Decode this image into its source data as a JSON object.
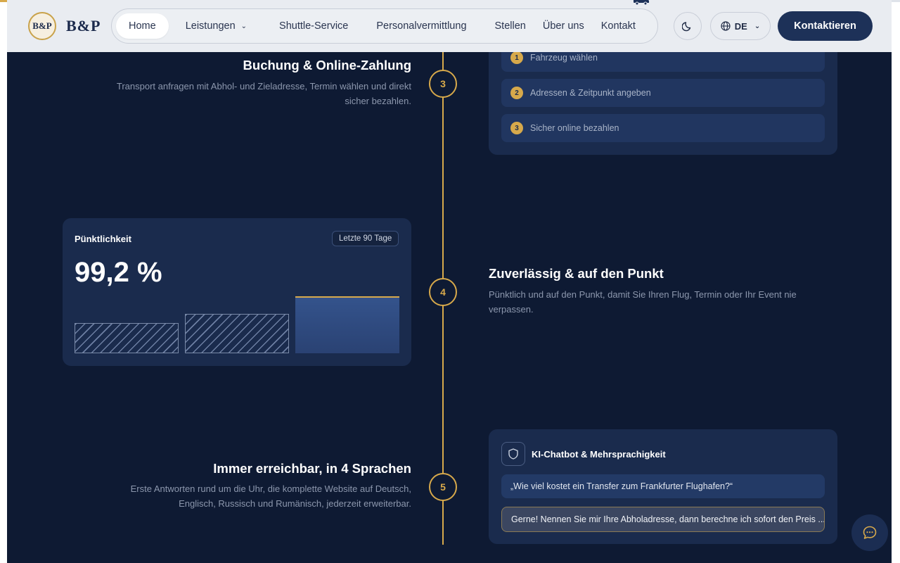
{
  "progress": {
    "fraction": 0.5
  },
  "brand": {
    "seal_text": "B&P",
    "wordmark": "B&P"
  },
  "nav": {
    "items": [
      {
        "label": "Home"
      },
      {
        "label": "Leistungen"
      },
      {
        "label": "Shuttle-Service"
      },
      {
        "label": "Personalvermittlung"
      },
      {
        "label": "Stellen"
      },
      {
        "label": "Über uns"
      },
      {
        "label": "Kontakt"
      }
    ],
    "dropdown_chevron": "⌄"
  },
  "header": {
    "theme_icon": "moon-icon",
    "language": "DE",
    "contact_label": "Kontaktieren"
  },
  "steps": [
    {
      "number": "3",
      "title": "Buchung & Online-Zahlung",
      "text": "Transport anfragen mit Abhol- und Zieladresse, Termin wählen und direkt sicher bezahlen."
    },
    {
      "number": "4",
      "title": "Zuverlässig & auf den Punkt",
      "text": "Pünktlich und auf den Punkt, damit Sie Ihren Flug, Termin oder Ihr Event nie verpassen."
    },
    {
      "number": "5",
      "title": "Immer erreichbar, in 4 Sprachen",
      "text": "Erste Antworten rund um die Uhr, die komplette Website auf Deutsch, Englisch, Russisch und Rumänisch, jederzeit erweiterbar."
    }
  ],
  "booking_card": {
    "items": [
      {
        "num": "1",
        "label": "Fahrzeug wählen"
      },
      {
        "num": "2",
        "label": "Adressen & Zeitpunkt angeben"
      },
      {
        "num": "3",
        "label": "Sicher online bezahlen"
      }
    ]
  },
  "punctuality_card": {
    "label": "Pünktlichkeit",
    "period": "Letzte 90 Tage",
    "value": "99,2 %",
    "bars": [
      0.43,
      0.56,
      0.81
    ]
  },
  "chat_card": {
    "icon": "shield-icon",
    "title": "KI-Chatbot & Mehrsprachigkeit",
    "question": "„Wie viel kostet ein Transfer zum Frankfurter Flughafen?“",
    "answer": "Gerne! Nennen Sie mir Ihre Abholadresse, dann berechne ich sofort den Preis ..."
  },
  "colors": {
    "accent": "#d7a94b",
    "background": "#0e1a33",
    "card": "#1a2b4d",
    "button": "#1d3158"
  }
}
